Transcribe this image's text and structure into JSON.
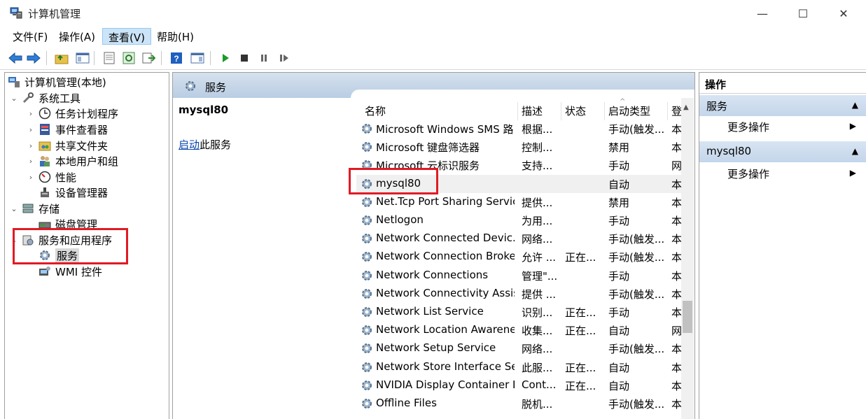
{
  "window": {
    "title": "计算机管理",
    "min_glyph": "—",
    "max_glyph": "☐",
    "close_glyph": "✕"
  },
  "menu": [
    "文件(F)",
    "操作(A)",
    "查看(V)",
    "帮助(H)"
  ],
  "tree": {
    "root": "计算机管理(本地)",
    "system_tools": "系统工具",
    "task_scheduler": "任务计划程序",
    "event_viewer": "事件查看器",
    "shared_folders": "共享文件夹",
    "local_users": "本地用户和组",
    "performance": "性能",
    "device_manager": "设备管理器",
    "storage": "存储",
    "disk_management": "磁盘管理",
    "services_apps": "服务和应用程序",
    "services": "服务",
    "wmi": "WMI 控件"
  },
  "middle": {
    "header": "服务",
    "selected_service": "mysql80",
    "start_link": "启动",
    "start_suffix": "此服务",
    "columns": {
      "name": "名称",
      "desc": "描述",
      "state": "状态",
      "start_type": "启动类型",
      "login": "登"
    },
    "rows": [
      {
        "name": "Microsoft Windows SMS 路...",
        "desc": "根据...",
        "state": "",
        "start_type": "手动(触发...",
        "login": "本"
      },
      {
        "name": "Microsoft 键盘筛选器",
        "desc": "控制...",
        "state": "",
        "start_type": "禁用",
        "login": "本"
      },
      {
        "name": "Microsoft 云标识服务",
        "desc": "支持...",
        "state": "",
        "start_type": "手动",
        "login": "网"
      },
      {
        "name": "mysql80",
        "desc": "",
        "state": "",
        "start_type": "自动",
        "login": "本"
      },
      {
        "name": "Net.Tcp Port Sharing Service",
        "desc": "提供...",
        "state": "",
        "start_type": "禁用",
        "login": "本"
      },
      {
        "name": "Netlogon",
        "desc": "为用...",
        "state": "",
        "start_type": "手动",
        "login": "本"
      },
      {
        "name": "Network Connected Devic...",
        "desc": "网络...",
        "state": "",
        "start_type": "手动(触发...",
        "login": "本"
      },
      {
        "name": "Network Connection Broker",
        "desc": "允许 ...",
        "state": "正在...",
        "start_type": "手动(触发...",
        "login": "本"
      },
      {
        "name": "Network Connections",
        "desc": "管理\"...",
        "state": "",
        "start_type": "手动",
        "login": "本"
      },
      {
        "name": "Network Connectivity Assis...",
        "desc": "提供 ...",
        "state": "",
        "start_type": "手动(触发...",
        "login": "本"
      },
      {
        "name": "Network List Service",
        "desc": "识别...",
        "state": "正在...",
        "start_type": "手动",
        "login": "本"
      },
      {
        "name": "Network Location Awarene...",
        "desc": "收集...",
        "state": "正在...",
        "start_type": "自动",
        "login": "网"
      },
      {
        "name": "Network Setup Service",
        "desc": "网络...",
        "state": "",
        "start_type": "手动(触发...",
        "login": "本"
      },
      {
        "name": "Network Store Interface Se...",
        "desc": "此服...",
        "state": "正在...",
        "start_type": "自动",
        "login": "本"
      },
      {
        "name": "NVIDIA Display Container LS",
        "desc": "Cont...",
        "state": "正在...",
        "start_type": "自动",
        "login": "本"
      },
      {
        "name": "Offline Files",
        "desc": "脱机...",
        "state": "",
        "start_type": "手动(触发...",
        "login": "本"
      }
    ]
  },
  "actions": {
    "title": "操作",
    "sec1": "服务",
    "more1": "更多操作",
    "sec2": "mysql80",
    "more2": "更多操作"
  },
  "colors": {
    "highlight_red": "#e01b24",
    "header_blue": "#c4d6ea",
    "link_blue": "#0645ad"
  }
}
